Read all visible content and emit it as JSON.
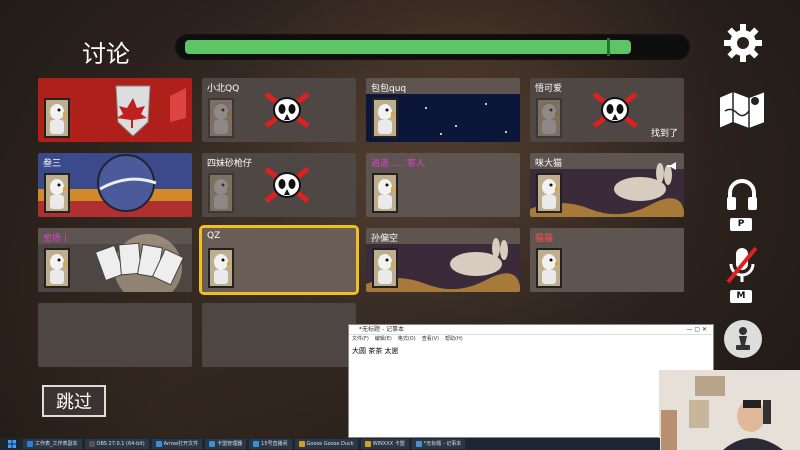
{
  "header": {
    "title": "讨论",
    "timer_progress": 0.9
  },
  "players": [
    {
      "name": "",
      "state": "alive",
      "banner": "canada"
    },
    {
      "name": "小北QQ",
      "state": "dead"
    },
    {
      "name": "包包quq",
      "state": "alive",
      "banner": "space"
    },
    {
      "name": "悟可爱",
      "state": "dead",
      "status": "找到了"
    },
    {
      "name": "叁三",
      "state": "alive",
      "banner": "planet"
    },
    {
      "name": "四妹砂枪仔",
      "state": "dead"
    },
    {
      "name": "逍遥……客人",
      "state": "alive",
      "name_color": "pink"
    },
    {
      "name": "咪大猫",
      "state": "alive",
      "banner": "rabbit",
      "speaking": true
    },
    {
      "name": "愈扬丨",
      "state": "alive",
      "name_color": "pink",
      "banner": "cards"
    },
    {
      "name": "QZ",
      "state": "alive",
      "selected": true
    },
    {
      "name": "孙偏空",
      "state": "alive",
      "banner": "rabbit"
    },
    {
      "name": "猫猫",
      "state": "alive",
      "name_color": "red"
    },
    {
      "name": "",
      "state": "empty"
    },
    {
      "name": "",
      "state": "empty"
    }
  ],
  "controls": {
    "skip_label": "跳过",
    "settings_icon": "gear-icon",
    "map_icon": "map-icon",
    "push_to_talk_key": "P",
    "mute_key": "M",
    "chess_icon": "chess-pawn-icon"
  },
  "notepad": {
    "title": "*无标题 - 记事本",
    "menu": [
      "文件(F)",
      "编辑(E)",
      "格式(O)",
      "查看(V)",
      "帮助(H)"
    ],
    "content": "大圆 茶茶 太崽"
  },
  "taskbar": {
    "items": [
      {
        "label": "工作表_工作表副本",
        "color": "#2f7fd4"
      },
      {
        "label": "OBS 27.0.1 (64-bit)",
        "color": "#555"
      },
      {
        "label": "Arrow打开文件",
        "color": "#3a8fdc"
      },
      {
        "label": "卡盟管理器",
        "color": "#3a8fdc"
      },
      {
        "label": "15号直播间",
        "color": "#3a8fdc"
      },
      {
        "label": "Goose Goose Duck",
        "color": "#d4a020"
      },
      {
        "label": "WINXXX 卡盟",
        "color": "#d4a020"
      },
      {
        "label": "*无标题 - 记事本",
        "color": "#4a8fd0"
      }
    ]
  },
  "colors": {
    "timer": "#5cc566",
    "selected_outline": "#f0c020",
    "dead_x": "#e02020"
  }
}
